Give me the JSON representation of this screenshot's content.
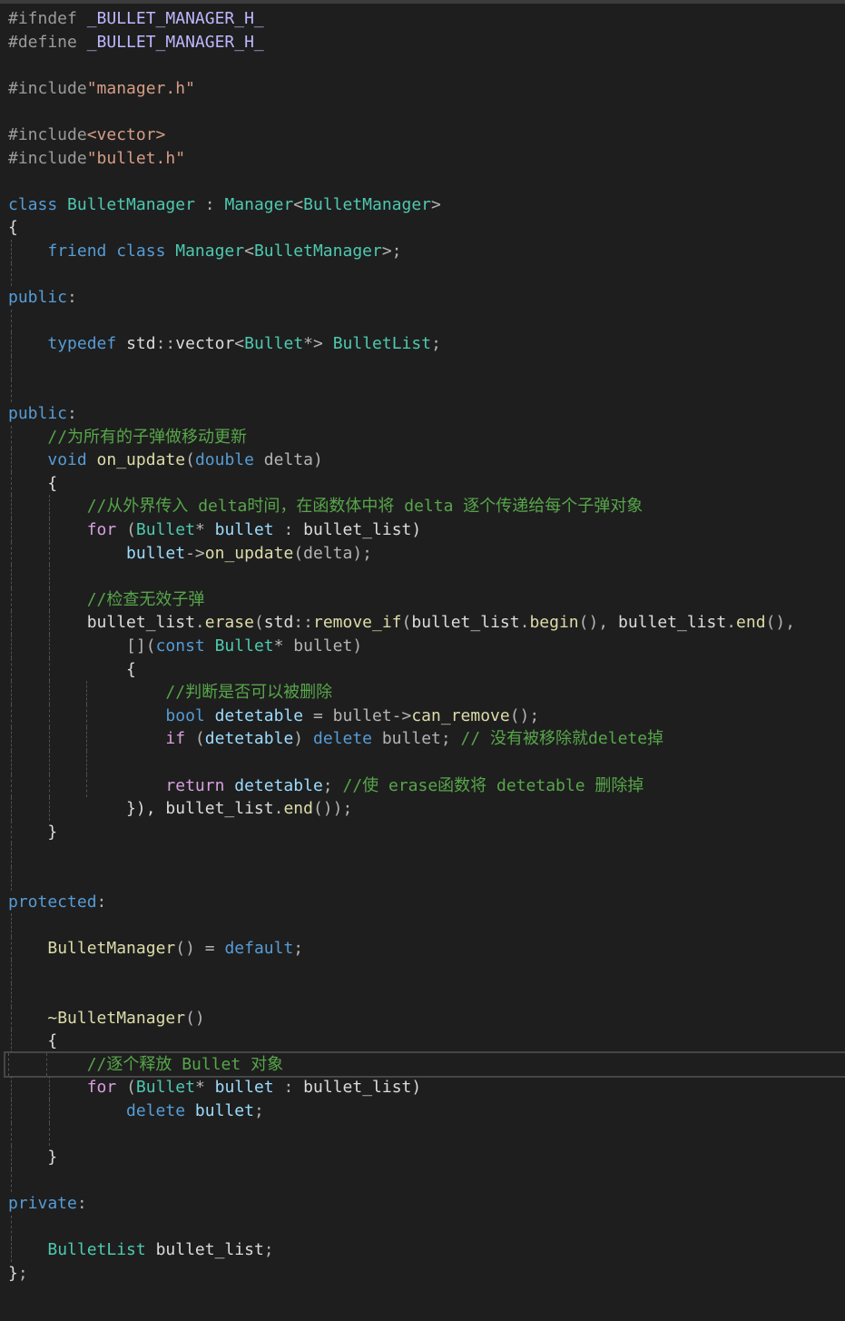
{
  "editor": {
    "lines": [
      {
        "i": [],
        "t": [
          {
            "c": "pp",
            "s": "#ifndef "
          },
          {
            "c": "mac",
            "s": "_BULLET_MANAGER_H_"
          }
        ]
      },
      {
        "i": [],
        "t": [
          {
            "c": "pp",
            "s": "#define "
          },
          {
            "c": "mac",
            "s": "_BULLET_MANAGER_H_"
          }
        ]
      },
      {
        "i": [],
        "t": []
      },
      {
        "i": [],
        "t": [
          {
            "c": "pp",
            "s": "#include"
          },
          {
            "c": "str",
            "s": "\"manager.h\""
          }
        ]
      },
      {
        "i": [],
        "t": []
      },
      {
        "i": [],
        "t": [
          {
            "c": "pp",
            "s": "#include"
          },
          {
            "c": "str",
            "s": "<vector>"
          }
        ]
      },
      {
        "i": [],
        "t": [
          {
            "c": "pp",
            "s": "#include"
          },
          {
            "c": "str",
            "s": "\"bullet.h\""
          }
        ]
      },
      {
        "i": [],
        "t": []
      },
      {
        "i": [],
        "t": [
          {
            "c": "kw",
            "s": "class "
          },
          {
            "c": "ty",
            "s": "BulletManager"
          },
          {
            "c": "op",
            "s": " : "
          },
          {
            "c": "ty",
            "s": "Manager"
          },
          {
            "c": "op",
            "s": "<"
          },
          {
            "c": "ty",
            "s": "BulletManager"
          },
          {
            "c": "op",
            "s": ">"
          }
        ]
      },
      {
        "i": [],
        "t": [
          {
            "c": "pn",
            "s": "{"
          }
        ]
      },
      {
        "i": [
          0
        ],
        "t": [
          {
            "c": "pn",
            "s": "    "
          },
          {
            "c": "kw",
            "s": "friend class "
          },
          {
            "c": "ty",
            "s": "Manager"
          },
          {
            "c": "op",
            "s": "<"
          },
          {
            "c": "ty",
            "s": "BulletManager"
          },
          {
            "c": "op",
            "s": ">;"
          }
        ]
      },
      {
        "i": [
          0
        ],
        "t": []
      },
      {
        "i": [],
        "t": [
          {
            "c": "kw",
            "s": "public"
          },
          {
            "c": "op",
            "s": ":"
          }
        ]
      },
      {
        "i": [
          0
        ],
        "t": []
      },
      {
        "i": [
          0
        ],
        "t": [
          {
            "c": "pn",
            "s": "    "
          },
          {
            "c": "kw",
            "s": "typedef "
          },
          {
            "c": "pn",
            "s": "std"
          },
          {
            "c": "op",
            "s": "::"
          },
          {
            "c": "pn",
            "s": "vector"
          },
          {
            "c": "op",
            "s": "<"
          },
          {
            "c": "ty",
            "s": "Bullet"
          },
          {
            "c": "op",
            "s": "*> "
          },
          {
            "c": "ty",
            "s": "BulletList"
          },
          {
            "c": "op",
            "s": ";"
          }
        ]
      },
      {
        "i": [
          0
        ],
        "t": []
      },
      {
        "i": [
          0
        ],
        "t": []
      },
      {
        "i": [],
        "t": [
          {
            "c": "kw",
            "s": "public"
          },
          {
            "c": "op",
            "s": ":"
          }
        ]
      },
      {
        "i": [
          0
        ],
        "t": [
          {
            "c": "pn",
            "s": "    "
          },
          {
            "c": "cm",
            "s": "//为所有的子弹做移动更新"
          }
        ]
      },
      {
        "i": [
          0
        ],
        "t": [
          {
            "c": "pn",
            "s": "    "
          },
          {
            "c": "kw",
            "s": "void "
          },
          {
            "c": "fn",
            "s": "on_update"
          },
          {
            "c": "op",
            "s": "("
          },
          {
            "c": "kw",
            "s": "double "
          },
          {
            "c": "op",
            "s": "delta)"
          }
        ]
      },
      {
        "i": [
          0
        ],
        "t": [
          {
            "c": "pn",
            "s": "    {"
          }
        ]
      },
      {
        "i": [
          0,
          1
        ],
        "t": [
          {
            "c": "pn",
            "s": "        "
          },
          {
            "c": "cm",
            "s": "//从外界传入 delta时间，在函数体中将 delta 逐个传递给每个子弹对象"
          }
        ]
      },
      {
        "i": [
          0,
          1
        ],
        "t": [
          {
            "c": "pn",
            "s": "        "
          },
          {
            "c": "ctl",
            "s": "for "
          },
          {
            "c": "op",
            "s": "("
          },
          {
            "c": "ty",
            "s": "Bullet"
          },
          {
            "c": "op",
            "s": "* "
          },
          {
            "c": "var",
            "s": "bullet"
          },
          {
            "c": "op",
            "s": " : "
          },
          {
            "c": "pn",
            "s": "bullet_list)"
          }
        ]
      },
      {
        "i": [
          0,
          1
        ],
        "t": [
          {
            "c": "pn",
            "s": "            "
          },
          {
            "c": "var",
            "s": "bullet"
          },
          {
            "c": "op",
            "s": "->"
          },
          {
            "c": "fn",
            "s": "on_update"
          },
          {
            "c": "op",
            "s": "(delta);"
          }
        ]
      },
      {
        "i": [
          0,
          1
        ],
        "t": []
      },
      {
        "i": [
          0,
          1
        ],
        "t": [
          {
            "c": "pn",
            "s": "        "
          },
          {
            "c": "cm",
            "s": "//检查无效子弹"
          }
        ]
      },
      {
        "i": [
          0,
          1
        ],
        "t": [
          {
            "c": "pn",
            "s": "        bullet_list"
          },
          {
            "c": "op",
            "s": "."
          },
          {
            "c": "fn",
            "s": "erase"
          },
          {
            "c": "op",
            "s": "("
          },
          {
            "c": "pn",
            "s": "std"
          },
          {
            "c": "op",
            "s": "::"
          },
          {
            "c": "fn",
            "s": "remove_if"
          },
          {
            "c": "op",
            "s": "("
          },
          {
            "c": "pn",
            "s": "bullet_list"
          },
          {
            "c": "op",
            "s": "."
          },
          {
            "c": "fn",
            "s": "begin"
          },
          {
            "c": "op",
            "s": "(), "
          },
          {
            "c": "pn",
            "s": "bullet_list"
          },
          {
            "c": "op",
            "s": "."
          },
          {
            "c": "fn",
            "s": "end"
          },
          {
            "c": "op",
            "s": "(),"
          }
        ]
      },
      {
        "i": [
          0,
          1
        ],
        "t": [
          {
            "c": "pn",
            "s": "            "
          },
          {
            "c": "op",
            "s": "[]("
          },
          {
            "c": "kw",
            "s": "const "
          },
          {
            "c": "ty",
            "s": "Bullet"
          },
          {
            "c": "op",
            "s": "* bullet)"
          }
        ]
      },
      {
        "i": [
          0,
          1
        ],
        "t": [
          {
            "c": "pn",
            "s": "            {"
          }
        ]
      },
      {
        "i": [
          0,
          1,
          2
        ],
        "t": [
          {
            "c": "pn",
            "s": "                "
          },
          {
            "c": "cm",
            "s": "//判断是否可以被删除"
          }
        ]
      },
      {
        "i": [
          0,
          1,
          2
        ],
        "t": [
          {
            "c": "pn",
            "s": "                "
          },
          {
            "c": "kw",
            "s": "bool "
          },
          {
            "c": "var",
            "s": "detetable"
          },
          {
            "c": "op",
            "s": " = bullet->"
          },
          {
            "c": "fn",
            "s": "can_remove"
          },
          {
            "c": "op",
            "s": "();"
          }
        ]
      },
      {
        "i": [
          0,
          1,
          2
        ],
        "t": [
          {
            "c": "pn",
            "s": "                "
          },
          {
            "c": "ctl",
            "s": "if "
          },
          {
            "c": "op",
            "s": "("
          },
          {
            "c": "var",
            "s": "detetable"
          },
          {
            "c": "op",
            "s": ") "
          },
          {
            "c": "kw",
            "s": "delete "
          },
          {
            "c": "op",
            "s": "bullet; "
          },
          {
            "c": "cm",
            "s": "// 没有被移除就delete掉"
          }
        ]
      },
      {
        "i": [
          0,
          1,
          2
        ],
        "t": []
      },
      {
        "i": [
          0,
          1,
          2
        ],
        "t": [
          {
            "c": "pn",
            "s": "                "
          },
          {
            "c": "ctl",
            "s": "return "
          },
          {
            "c": "var",
            "s": "detetable"
          },
          {
            "c": "op",
            "s": "; "
          },
          {
            "c": "cm",
            "s": "//使 erase函数将 detetable 删除掉"
          }
        ]
      },
      {
        "i": [
          0,
          1
        ],
        "t": [
          {
            "c": "pn",
            "s": "            }), bullet_list"
          },
          {
            "c": "op",
            "s": "."
          },
          {
            "c": "fn",
            "s": "end"
          },
          {
            "c": "op",
            "s": "());"
          }
        ]
      },
      {
        "i": [
          0
        ],
        "t": [
          {
            "c": "pn",
            "s": "    }"
          }
        ]
      },
      {
        "i": [
          0
        ],
        "t": []
      },
      {
        "i": [
          0
        ],
        "t": []
      },
      {
        "i": [],
        "t": [
          {
            "c": "kw",
            "s": "protected"
          },
          {
            "c": "op",
            "s": ":"
          }
        ]
      },
      {
        "i": [
          0
        ],
        "t": []
      },
      {
        "i": [
          0
        ],
        "t": [
          {
            "c": "pn",
            "s": "    "
          },
          {
            "c": "fn",
            "s": "BulletManager"
          },
          {
            "c": "op",
            "s": "() = "
          },
          {
            "c": "kw",
            "s": "default"
          },
          {
            "c": "op",
            "s": ";"
          }
        ]
      },
      {
        "i": [
          0
        ],
        "t": []
      },
      {
        "i": [
          0
        ],
        "t": []
      },
      {
        "i": [
          0
        ],
        "t": [
          {
            "c": "pn",
            "s": "    "
          },
          {
            "c": "fn",
            "s": "~BulletManager"
          },
          {
            "c": "op",
            "s": "()"
          }
        ]
      },
      {
        "i": [
          0
        ],
        "t": [
          {
            "c": "pn",
            "s": "    {"
          }
        ]
      },
      {
        "i": [
          0,
          1
        ],
        "t": [
          {
            "c": "pn",
            "s": "        "
          },
          {
            "c": "cm",
            "s": "//逐个释放 Bullet 对象"
          }
        ],
        "current": true
      },
      {
        "i": [
          0,
          1
        ],
        "t": [
          {
            "c": "pn",
            "s": "        "
          },
          {
            "c": "ctl",
            "s": "for "
          },
          {
            "c": "op",
            "s": "("
          },
          {
            "c": "ty",
            "s": "Bullet"
          },
          {
            "c": "op",
            "s": "* "
          },
          {
            "c": "var",
            "s": "bullet"
          },
          {
            "c": "op",
            "s": " : "
          },
          {
            "c": "pn",
            "s": "bullet_list)"
          }
        ]
      },
      {
        "i": [
          0,
          1
        ],
        "t": [
          {
            "c": "pn",
            "s": "            "
          },
          {
            "c": "kw",
            "s": "delete "
          },
          {
            "c": "var",
            "s": "bullet"
          },
          {
            "c": "op",
            "s": ";"
          }
        ]
      },
      {
        "i": [
          0,
          1
        ],
        "t": []
      },
      {
        "i": [
          0
        ],
        "t": [
          {
            "c": "pn",
            "s": "    }"
          }
        ]
      },
      {
        "i": [
          0
        ],
        "t": []
      },
      {
        "i": [],
        "t": [
          {
            "c": "kw",
            "s": "private"
          },
          {
            "c": "op",
            "s": ":"
          }
        ]
      },
      {
        "i": [
          0
        ],
        "t": []
      },
      {
        "i": [
          0
        ],
        "t": [
          {
            "c": "pn",
            "s": "    "
          },
          {
            "c": "ty",
            "s": "BulletList"
          },
          {
            "c": "pn",
            "s": " bullet_list"
          },
          {
            "c": "op",
            "s": ";"
          }
        ]
      },
      {
        "i": [],
        "t": [
          {
            "c": "pn",
            "s": "}"
          },
          {
            "c": "op",
            "s": ";"
          }
        ]
      }
    ]
  }
}
